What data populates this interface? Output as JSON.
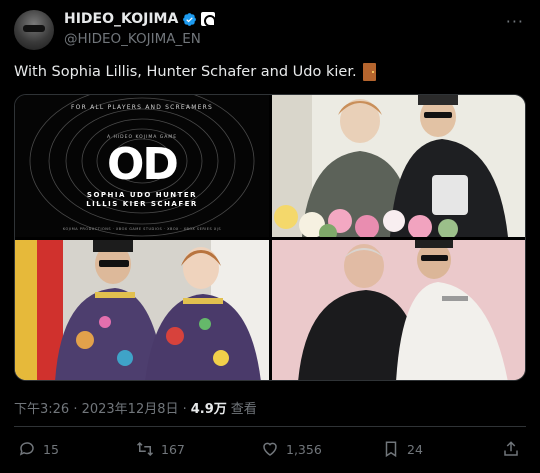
{
  "author": {
    "name": "HIDEO_KOJIMA",
    "handle": "@HIDEO_KOJIMA_EN",
    "more_label": "···"
  },
  "tweet": {
    "text": "With Sophia Lillis, Hunter Schafer and Udo kier.",
    "emoji_icon": "door-icon"
  },
  "poster": {
    "top_line": "FOR ALL PLAYERS AND SCREAMERS",
    "subtitle": "A HIDEO KOJIMA GAME",
    "title": "OD",
    "cast_line1": "SOPHIA   UDO   HUNTER",
    "cast_line2": "LILLIS   KIER   SCHAFER",
    "logos_line": "KOJIMA PRODUCTIONS · XBOX GAME STUDIOS · XBOX · XBOX SERIES X|S"
  },
  "meta": {
    "time": "下午3:26 · 2023年12月8日 ·",
    "views": "4.9万",
    "views_label": "查看"
  },
  "stats": {
    "replies": "15",
    "retweets": "167",
    "likes": "1,356",
    "bookmarks": "24"
  },
  "colors": {
    "background": "#000000",
    "text": "#e7e9ea",
    "muted": "#71767b",
    "verified": "#1d9bf0",
    "border": "#2f3336"
  }
}
